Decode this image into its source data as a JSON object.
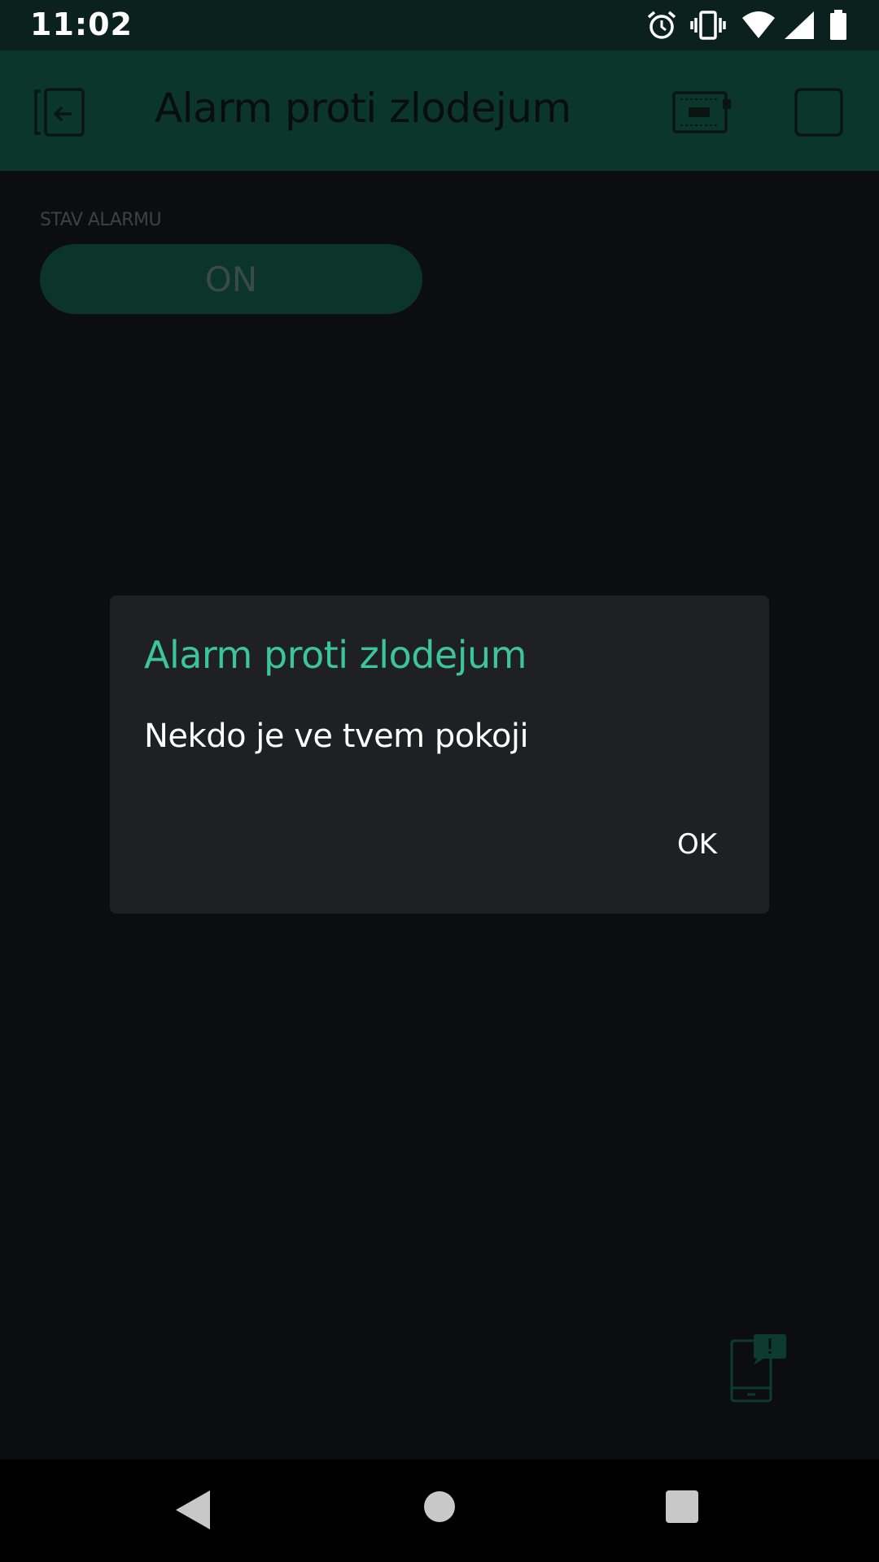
{
  "status_bar": {
    "time": "11:02",
    "icons": [
      "alarm-icon",
      "vibrate-icon",
      "wifi-icon",
      "cell-signal-icon",
      "battery-icon"
    ]
  },
  "app_bar": {
    "title": "Alarm proti zlodejum",
    "left_icon": "exit-project-icon",
    "right_icons": [
      "device-board-icon",
      "square-icon"
    ],
    "background": "#0b372b"
  },
  "widget": {
    "label": "STAV ALARMU",
    "button_label": "ON",
    "button_color": "#0b3529"
  },
  "dialog": {
    "title": "Alarm proti zlodejum",
    "message": "Nekdo je ve tvem pokoji",
    "ok_label": "OK",
    "title_color": "#3cc49a"
  },
  "notification_icon": "phone-notification-icon",
  "nav_bar": {
    "buttons": [
      "back-icon",
      "home-icon",
      "recents-icon"
    ]
  }
}
